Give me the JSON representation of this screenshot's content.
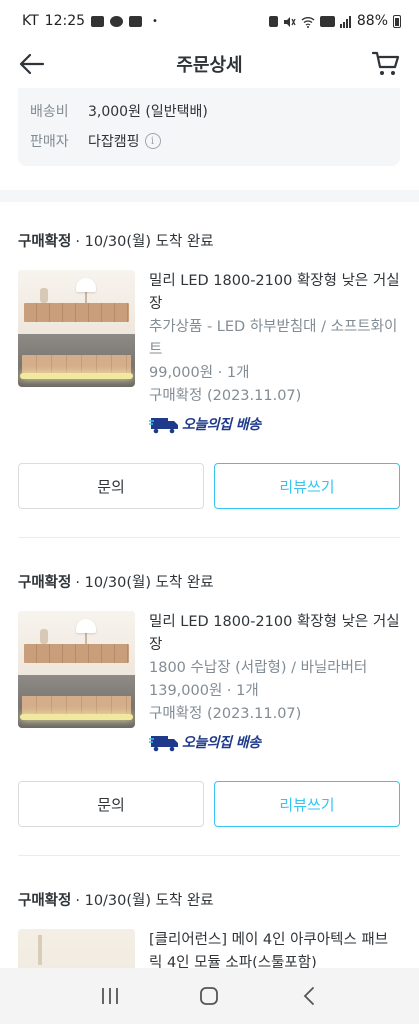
{
  "status_bar": {
    "carrier": "KT",
    "time": "12:25",
    "dot": "•",
    "battery_percent": "88%"
  },
  "header": {
    "title": "주문상세",
    "back_icon": "arrow-left-icon",
    "cart_icon": "cart-icon"
  },
  "shipping_info": {
    "fee_label": "배송비",
    "fee_value": "3,000원 (일반택배)",
    "seller_label": "판매자",
    "seller_value": "다잡캠핑",
    "seller_info_icon": "info-icon"
  },
  "orders": [
    {
      "status_strong": "구매확정",
      "status_rest": "· 10/30(월) 도착 완료",
      "name": "밀리 LED 1800-2100 확장형 낮은 거실장",
      "option": "추가상품 - LED 하부받침대 / 소프트화이트",
      "price": "99,000원 · 1개",
      "confirm": "구매확정 (2023.11.07)",
      "delivery": "오늘의집 배송",
      "inquiry_label": "문의",
      "review_label": "리뷰쓰기"
    },
    {
      "status_strong": "구매확정",
      "status_rest": "· 10/30(월) 도착 완료",
      "name": "밀리 LED 1800-2100 확장형 낮은 거실장",
      "option": "1800 수납장 (서랍형) / 바닐라버터",
      "price": "139,000원 · 1개",
      "confirm": "구매확정 (2023.11.07)",
      "delivery": "오늘의집 배송",
      "inquiry_label": "문의",
      "review_label": "리뷰쓰기"
    },
    {
      "status_strong": "구매확정",
      "status_rest": "· 10/30(월) 도착 완료",
      "name": "[클리어런스] 메이 4인 아쿠아텍스 패브릭 4인 모듈 소파(스툴포함)"
    }
  ],
  "nav_bar": {
    "recents_icon": "recents-icon",
    "home_icon": "home-icon",
    "back_icon": "back-chevron-icon"
  },
  "colors": {
    "accent": "#35c5f0",
    "text": "#2f3438",
    "muted": "#828c94",
    "delivery_blue": "#1f3a8a"
  }
}
